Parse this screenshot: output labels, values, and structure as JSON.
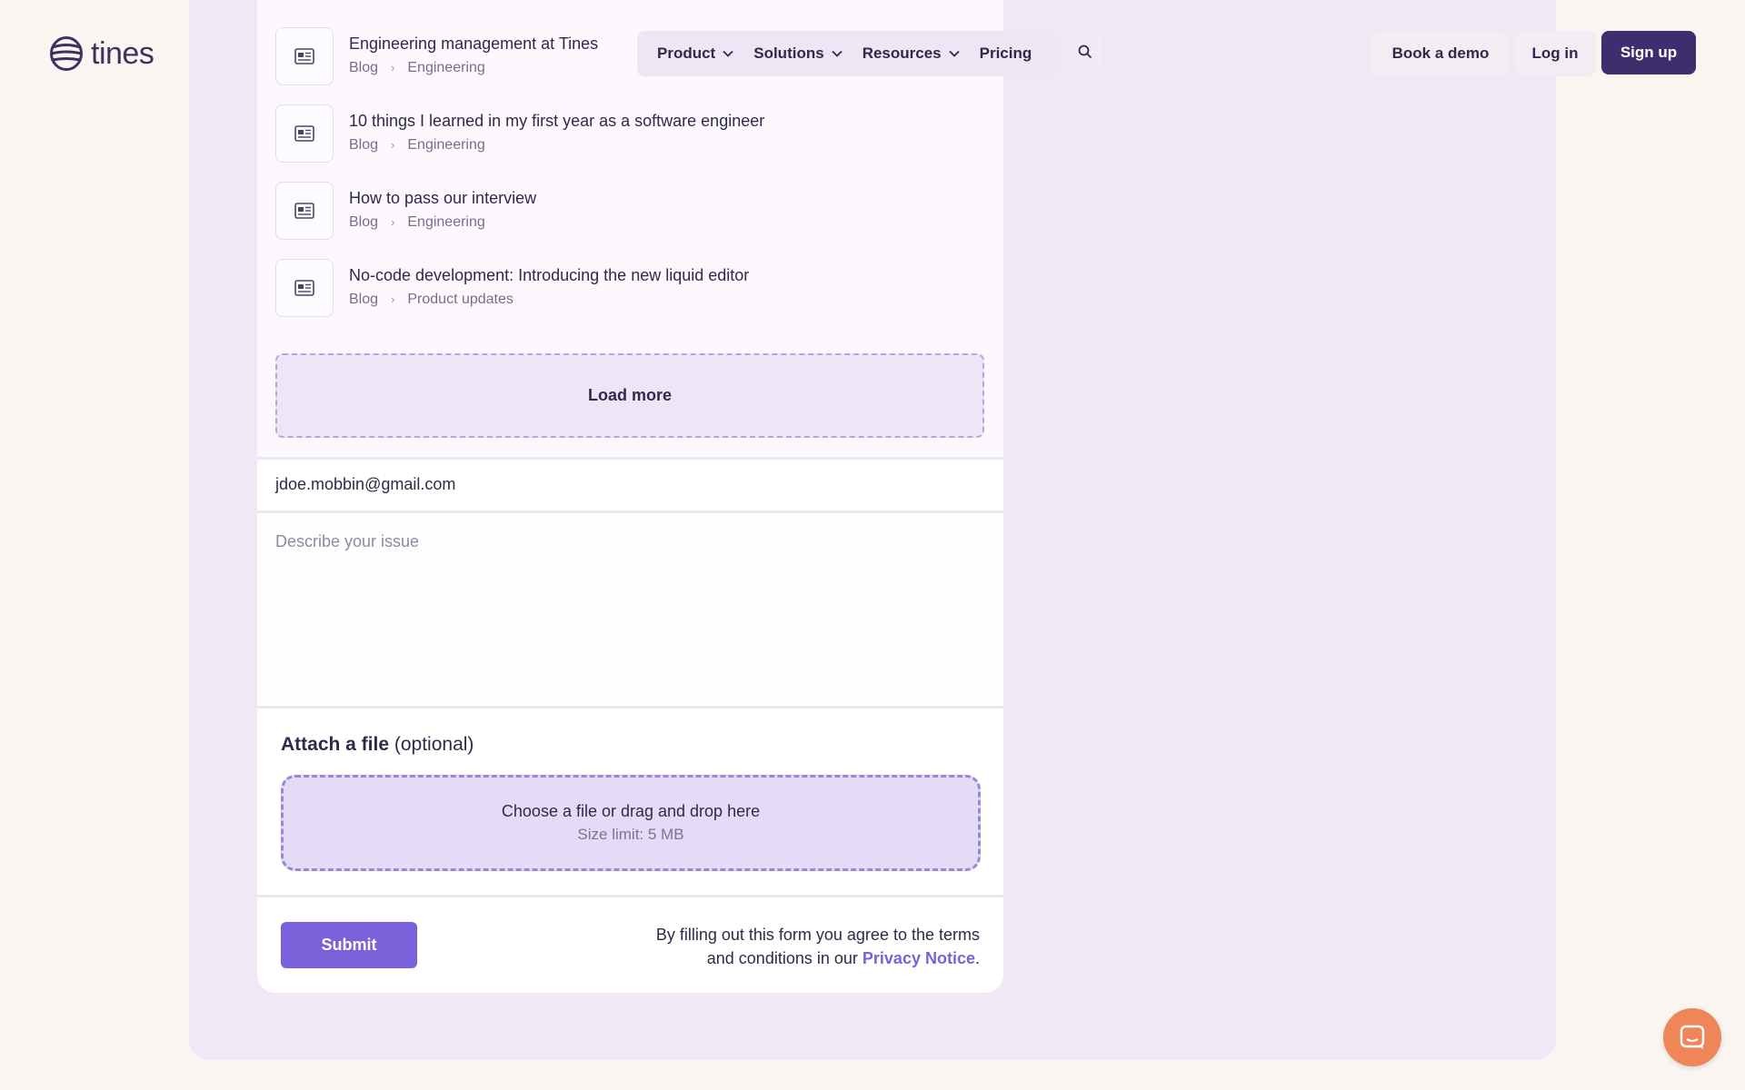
{
  "header": {
    "logo_text": "tines",
    "nav": [
      {
        "label": "Product",
        "dropdown": true
      },
      {
        "label": "Solutions",
        "dropdown": true
      },
      {
        "label": "Resources",
        "dropdown": true
      },
      {
        "label": "Pricing",
        "dropdown": false
      }
    ],
    "book_demo": "Book a demo",
    "log_in": "Log in",
    "sign_up": "Sign up"
  },
  "results": [
    {
      "title": "Engineering management at Tines",
      "crumbs": [
        "Blog",
        "Engineering"
      ],
      "icon": "article-icon"
    },
    {
      "title": "10 things I learned in my first year as a software engineer",
      "crumbs": [
        "Blog",
        "Engineering"
      ],
      "icon": "article-icon"
    },
    {
      "title": "How to pass our interview",
      "crumbs": [
        "Blog",
        "Engineering"
      ],
      "icon": "article-icon"
    },
    {
      "title": "No-code development: Introducing the new liquid editor",
      "crumbs": [
        "Blog",
        "Product updates"
      ],
      "icon": "article-icon"
    }
  ],
  "load_more": "Load more",
  "form": {
    "email_value": "jdoe.mobbin@gmail.com",
    "issue_placeholder": "Describe your issue",
    "attach_label_bold": "Attach a file",
    "attach_label_rest": "(optional)",
    "dropzone_main": "Choose a file or drag and drop here",
    "dropzone_sub": "Size limit: 5 MB",
    "submit": "Submit",
    "terms_line1": "By filling out this form you agree to the terms",
    "terms_line2_prefix": "and conditions in our",
    "terms_link": "Privacy Notice",
    "terms_suffix": "."
  },
  "colors": {
    "accent": "#7a61d9",
    "primary_dark": "#3d2f6e",
    "chat": "#f0855a"
  }
}
